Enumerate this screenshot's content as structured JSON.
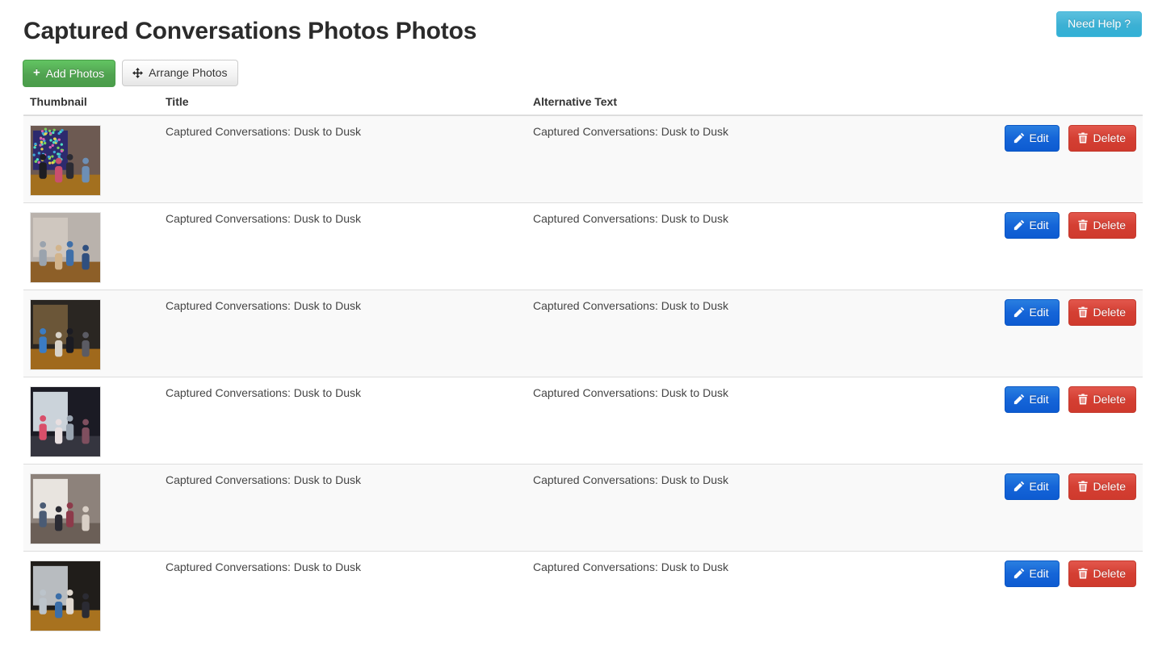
{
  "header": {
    "title": "Captured Conversations Photos Photos",
    "need_help_label": "Need Help ?",
    "need_help_icon": "question-mark",
    "need_help_color": "#5bc0de"
  },
  "toolbar": {
    "add_photos_label": "Add Photos",
    "add_photos_icon": "plus-icon",
    "add_photos_color": "#51a351",
    "arrange_photos_label": "Arrange Photos",
    "arrange_photos_icon": "move-arrows-icon",
    "arrange_photos_color": "#e6e6e6"
  },
  "table": {
    "columns": [
      {
        "key": "thumbnail",
        "label": "Thumbnail"
      },
      {
        "key": "title",
        "label": "Title"
      },
      {
        "key": "alt",
        "label": "Alternative Text"
      },
      {
        "key": "actions",
        "label": ""
      }
    ],
    "row_actions": {
      "edit_label": "Edit",
      "edit_icon": "pencil-icon",
      "edit_color": "#1565d8",
      "delete_label": "Delete",
      "delete_icon": "trash-icon",
      "delete_color": "#d43f33"
    },
    "rows": [
      {
        "title": "Captured Conversations: Dusk to Dusk",
        "alt": "Captured Conversations: Dusk to Dusk",
        "thumbnail_alt": "Gallery visitors viewing a colorful mosaic artwork on a wood floor"
      },
      {
        "title": "Captured Conversations: Dusk to Dusk",
        "alt": "Captured Conversations: Dusk to Dusk",
        "thumbnail_alt": "Group of visitors standing in a gallery room"
      },
      {
        "title": "Captured Conversations: Dusk to Dusk",
        "alt": "Captured Conversations: Dusk to Dusk",
        "thumbnail_alt": "Three people in blue and plaid shirts talking near a wall display"
      },
      {
        "title": "Captured Conversations: Dusk to Dusk",
        "alt": "Captured Conversations: Dusk to Dusk",
        "thumbnail_alt": "Visitors looking at a lit exhibit case in a dark gallery"
      },
      {
        "title": "Captured Conversations: Dusk to Dusk",
        "alt": "Captured Conversations: Dusk to Dusk",
        "thumbnail_alt": "Two women conversing in front of framed artwork"
      },
      {
        "title": "Captured Conversations: Dusk to Dusk",
        "alt": "Captured Conversations: Dusk to Dusk",
        "thumbnail_alt": "Family beside a silver foil sculpture on a wood floor"
      }
    ]
  }
}
